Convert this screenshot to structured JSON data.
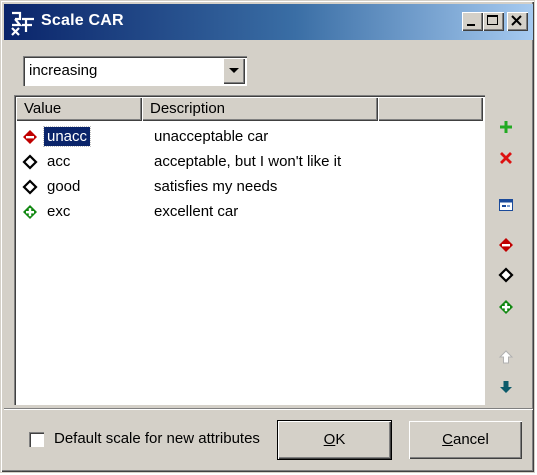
{
  "window": {
    "title": "Scale CAR"
  },
  "titlebar_buttons": [
    {
      "name": "minimize",
      "icon": "minimize-icon"
    },
    {
      "name": "maximize",
      "icon": "maximize-icon"
    },
    {
      "name": "close",
      "icon": "close-icon"
    }
  ],
  "order_select": {
    "value": "increasing"
  },
  "table": {
    "columns": [
      "Value",
      "Description"
    ],
    "rows": [
      {
        "value": "unacc",
        "description": "unacceptable car",
        "icon": "bad-value-icon",
        "color": "#c00000",
        "selected": true
      },
      {
        "value": "acc",
        "description": "acceptable, but I won't like it",
        "icon": "neutral-value-icon",
        "color": "#000000",
        "selected": false
      },
      {
        "value": "good",
        "description": "satisfies my needs",
        "icon": "neutral-value-icon",
        "color": "#000000",
        "selected": false
      },
      {
        "value": "exc",
        "description": "excellent car",
        "icon": "good-value-icon",
        "color": "#118811",
        "selected": false
      }
    ]
  },
  "toolbar": [
    {
      "name": "add-value",
      "icon": "plus-icon",
      "color": "#22aa22"
    },
    {
      "name": "delete-value",
      "icon": "x-icon",
      "color": "#dd1111"
    },
    {
      "name": "edit-value",
      "icon": "window-icon",
      "color": "#1a4a9a"
    },
    {
      "name": "mark-bad",
      "icon": "bad-value-icon",
      "color": "#c00000"
    },
    {
      "name": "mark-neutral",
      "icon": "neutral-value-icon",
      "color": "#000000"
    },
    {
      "name": "mark-good",
      "icon": "good-value-icon",
      "color": "#118811"
    },
    {
      "name": "move-up",
      "icon": "arrow-up-icon",
      "color": "#b0b0b0"
    },
    {
      "name": "move-down",
      "icon": "arrow-down-icon",
      "color": "#0b5a6a"
    }
  ],
  "footer": {
    "checkbox_label": "Default scale for new attributes",
    "checkbox_checked": false,
    "ok_label": "OK",
    "cancel_label": "Cancel"
  }
}
